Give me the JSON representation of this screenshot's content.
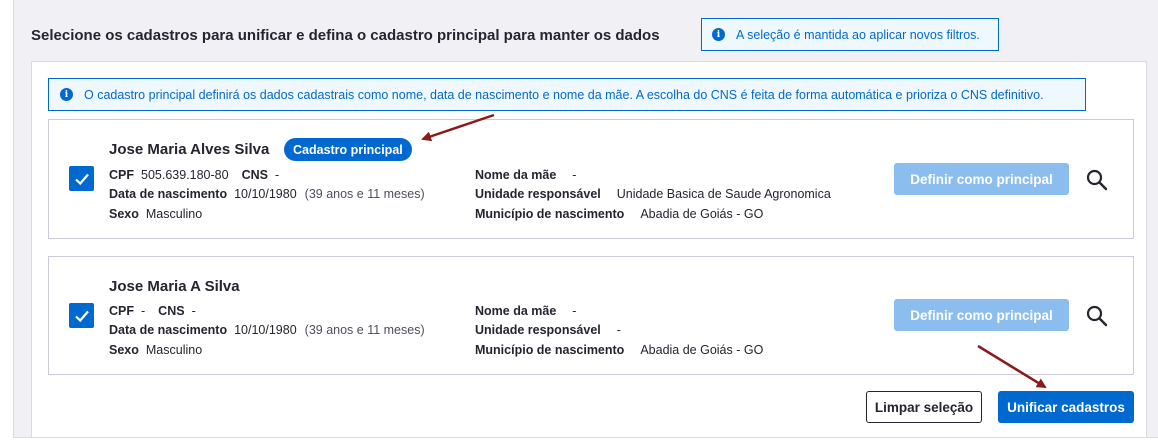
{
  "header": {
    "title": "Selecione os cadastros para unificar e defina o cadastro principal para manter os dados",
    "info_tag": "A seleção é mantida ao aplicar novos filtros."
  },
  "banner": {
    "text": "O cadastro principal definirá os dados cadastrais como nome, data de nascimento e nome da mãe. A escolha do CNS é feita de forma automática e prioriza o CNS definitivo."
  },
  "icons": {
    "info": "i"
  },
  "cards": [
    {
      "checked": true,
      "name": "Jose Maria Alves Silva",
      "badge": "Cadastro principal",
      "cpf_label": "CPF",
      "cpf": "505.639.180-80",
      "cns_label": "CNS",
      "cns": "-",
      "dob_label": "Data de nascimento",
      "dob": "10/10/1980",
      "age": "(39 anos e 11 meses)",
      "sex_label": "Sexo",
      "sex": "Masculino",
      "mother_label": "Nome da mãe",
      "mother": "-",
      "unit_label": "Unidade responsável",
      "unit": "Unidade Basica de Saude Agronomica",
      "city_label": "Município de nascimento",
      "city": "Abadia de Goiás - GO",
      "define_button": "Definir como principal"
    },
    {
      "checked": true,
      "name": "Jose Maria A Silva",
      "badge": "",
      "cpf_label": "CPF",
      "cpf": "-",
      "cns_label": "CNS",
      "cns": "-",
      "dob_label": "Data de nascimento",
      "dob": "10/10/1980",
      "age": "(39 anos e 11 meses)",
      "sex_label": "Sexo",
      "sex": "Masculino",
      "mother_label": "Nome da mãe",
      "mother": "-",
      "unit_label": "Unidade responsável",
      "unit": "-",
      "city_label": "Município de nascimento",
      "city": "Abadia de Goiás - GO",
      "define_button": "Definir como principal"
    }
  ],
  "footer": {
    "clear_button": "Limpar seleção",
    "unify_button": "Unificar cadastros"
  },
  "colors": {
    "primary": "#0069d0",
    "primary_disabled": "#8bbdee",
    "annotation_arrow": "#8b1a1a"
  }
}
